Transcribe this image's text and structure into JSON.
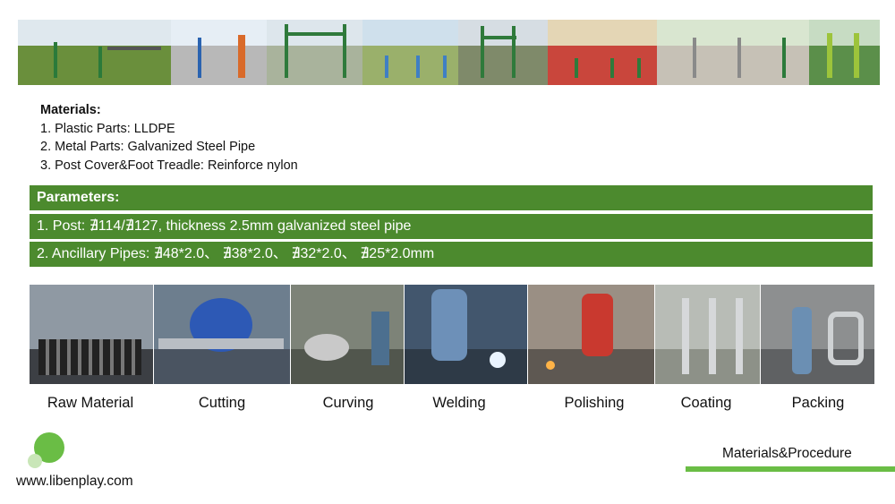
{
  "materials": {
    "title": "Materials:",
    "items": [
      "1. Plastic Parts: LLDPE",
      "2. Metal Parts: Galvanized Steel Pipe",
      "3. Post Cover&Foot Treadle: Reinforce nylon"
    ]
  },
  "parameters": {
    "title": "Parameters:",
    "post": "1. Post: ∄114/∄127, thickness 2.5mm galvanized steel pipe",
    "pipes": "2. Ancillary Pipes: ∄48*2.0、 ∄38*2.0、 ∄32*2.0、 ∄25*2.0mm"
  },
  "procedure": [
    {
      "label": "Raw Material"
    },
    {
      "label": "Cutting"
    },
    {
      "label": "Curving"
    },
    {
      "label": "Welding"
    },
    {
      "label": "Polishing"
    },
    {
      "label": "Coating"
    },
    {
      "label": "Packing"
    }
  ],
  "footer": {
    "website": "www.libenplay.com",
    "section_title": "Materials&Procedure"
  },
  "colors": {
    "band_green": "#4c8a2e",
    "accent_green": "#6abd45"
  }
}
